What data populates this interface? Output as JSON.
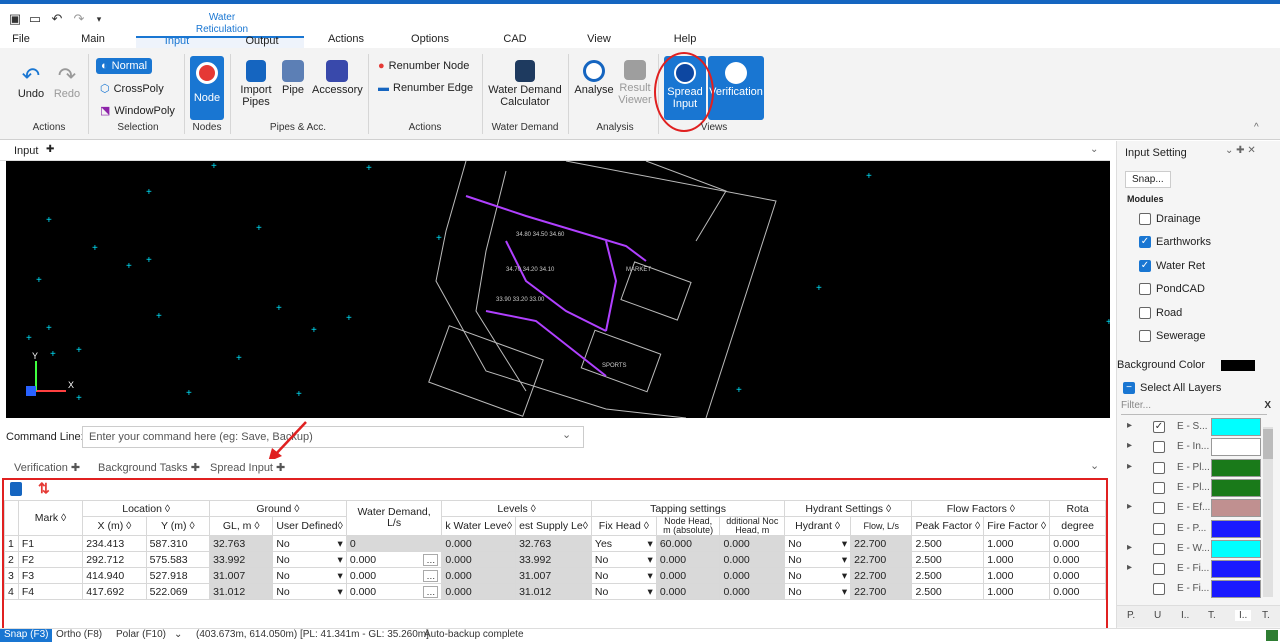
{
  "ribbon_tabs": {
    "file": "File",
    "main": "Main",
    "input": "Input",
    "water_reticulation": "Water Reticulation",
    "output": "Output",
    "actions": "Actions",
    "options": "Options",
    "cad": "CAD",
    "view": "View",
    "help": "Help"
  },
  "ribbon": {
    "undo": "Undo",
    "redo": "Redo",
    "normal": "Normal",
    "crosspoly": "CrossPoly",
    "windowpoly": "WindowPoly",
    "node": "Node",
    "import_pipes": "Import Pipes",
    "pipe": "Pipe",
    "accessory": "Accessory",
    "renumber_node": "Renumber Node",
    "renumber_edge": "Renumber Edge",
    "water_demand_calc": "Water Demand Calculator",
    "analyse": "Analyse",
    "result_viewer": "Result Viewer",
    "spread_input": "Spread Input",
    "verification": "Verification",
    "groups": {
      "actions": "Actions",
      "selection": "Selection",
      "nodes": "Nodes",
      "pipes_acc": "Pipes & Acc.",
      "actions2": "Actions",
      "water_demand": "Water Demand",
      "analysis": "Analysis",
      "views": "Views"
    }
  },
  "input_panel_title": "Input",
  "command": {
    "label": "Command Line:",
    "placeholder": "Enter your command here (eg: Save, Backup)"
  },
  "panel_tabs": {
    "verification": "Verification",
    "background_tasks": "Background Tasks",
    "spread_input": "Spread Input"
  },
  "grid": {
    "groups": {
      "mark": "Mark",
      "location": "Location",
      "ground": "Ground",
      "water_demand": "Water Demand, L/s",
      "levels": "Levels",
      "tapping": "Tapping settings",
      "hydrant": "Hydrant Settings",
      "flow_factors": "Flow Factors",
      "rota": "Rota"
    },
    "cols": {
      "x": "X (m)",
      "y": "Y (m)",
      "gl": "GL, m",
      "user_defined": "User Defined",
      "low_water": "k Water Leve",
      "lowest_supply": "est Supply Le",
      "fix_head": "Fix Head",
      "node_head": "Node Head, m (absolute)",
      "additional": "dditional Noc Head, m",
      "hydrant": "Hydrant",
      "flow": "Flow, L/s",
      "peak": "Peak Factor",
      "fire": "Fire Factor",
      "degree": "degree"
    },
    "rows": [
      {
        "n": "1",
        "mark": "F1",
        "x": "234.413",
        "y": "587.310",
        "gl": "32.763",
        "ud": "No",
        "wd": "0",
        "lw": "0.000",
        "ls": "32.763",
        "fh": "Yes",
        "nh": "60.000",
        "an": "0.000",
        "hy": "No",
        "fl": "22.700",
        "pk": "2.500",
        "fi": "1.000",
        "dg": "0.000"
      },
      {
        "n": "2",
        "mark": "F2",
        "x": "292.712",
        "y": "575.583",
        "gl": "33.992",
        "ud": "No",
        "wd": "0.000",
        "lw": "0.000",
        "ls": "33.992",
        "fh": "No",
        "nh": "0.000",
        "an": "0.000",
        "hy": "No",
        "fl": "22.700",
        "pk": "2.500",
        "fi": "1.000",
        "dg": "0.000"
      },
      {
        "n": "3",
        "mark": "F3",
        "x": "414.940",
        "y": "527.918",
        "gl": "31.007",
        "ud": "No",
        "wd": "0.000",
        "lw": "0.000",
        "ls": "31.007",
        "fh": "No",
        "nh": "0.000",
        "an": "0.000",
        "hy": "No",
        "fl": "22.700",
        "pk": "2.500",
        "fi": "1.000",
        "dg": "0.000"
      },
      {
        "n": "4",
        "mark": "F4",
        "x": "417.692",
        "y": "522.069",
        "gl": "31.012",
        "ud": "No",
        "wd": "0.000",
        "lw": "0.000",
        "ls": "31.012",
        "fh": "No",
        "nh": "0.000",
        "an": "0.000",
        "hy": "No",
        "fl": "22.700",
        "pk": "2.500",
        "fi": "1.000",
        "dg": "0.000"
      }
    ]
  },
  "status": {
    "snap": "Snap (F3)",
    "ortho": "Ortho (F8)",
    "polar": "Polar (F10)",
    "coords": "(403.673m, 614.050m) [PL: 41.341m - GL: 35.260m]",
    "msg": "Auto-backup complete"
  },
  "side": {
    "title": "Input Setting",
    "snap": "Snap...",
    "modules": "Modules",
    "module_items": [
      "Drainage",
      "Earthworks",
      "Water Ret",
      "PondCAD",
      "Road",
      "Sewerage"
    ],
    "bg_color": "Background Color",
    "select_all": "Select All Layers",
    "filter": "Filter...",
    "filter_clear": "X",
    "layers": [
      "E - S...",
      "E - In...",
      "E - Pl...",
      "E - Pl...",
      "E - Ef...",
      "E - P...",
      "E - W...",
      "E - Fi...",
      "E - Fi..."
    ],
    "bottom_tabs": [
      "P.",
      "U",
      "I..",
      "T.",
      "I..",
      "T."
    ]
  },
  "colors": {
    "accent": "#1976d2",
    "highlight": "#e02020"
  }
}
